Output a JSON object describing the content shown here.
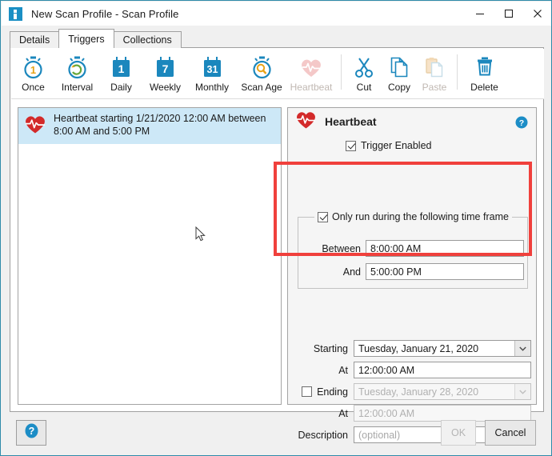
{
  "window": {
    "title": "New Scan Profile - Scan Profile",
    "icon": "app-icon",
    "controls": {
      "minimize": "minimize-icon",
      "maximize": "maximize-icon",
      "close": "close-icon"
    }
  },
  "tabs": [
    {
      "label": "Details",
      "active": false
    },
    {
      "label": "Triggers",
      "active": true
    },
    {
      "label": "Collections",
      "active": false
    }
  ],
  "toolbar": {
    "items": [
      {
        "label": "Once",
        "icon": "stopwatch-1-icon",
        "disabled": false
      },
      {
        "label": "Interval",
        "icon": "stopwatch-loop-icon",
        "disabled": false
      },
      {
        "label": "Daily",
        "icon": "calendar-1-icon",
        "disabled": false
      },
      {
        "label": "Weekly",
        "icon": "calendar-7-icon",
        "disabled": false
      },
      {
        "label": "Monthly",
        "icon": "calendar-31-icon",
        "disabled": false
      },
      {
        "label": "Scan Age",
        "icon": "stopwatch-search-icon",
        "disabled": false
      },
      {
        "label": "Heartbeat",
        "icon": "heartbeat-icon",
        "disabled": true
      }
    ],
    "clipboard": [
      {
        "label": "Cut",
        "icon": "scissors-icon",
        "disabled": false
      },
      {
        "label": "Copy",
        "icon": "copy-icon",
        "disabled": false
      },
      {
        "label": "Paste",
        "icon": "paste-icon",
        "disabled": true
      }
    ],
    "delete": {
      "label": "Delete",
      "icon": "trash-icon",
      "disabled": false
    }
  },
  "trigger_list": {
    "items": [
      {
        "icon": "heartbeat-icon",
        "text": "Heartbeat starting 1/21/2020 12:00 AM between 8:00 AM and 5:00 PM",
        "selected": true
      }
    ]
  },
  "detail": {
    "icon": "heartbeat-icon",
    "title": "Heartbeat",
    "help_icon": "help-icon",
    "trigger_enabled": {
      "label": "Trigger Enabled",
      "checked": true
    },
    "time_frame": {
      "label": "Only run during the following time frame",
      "checked": true,
      "highlighted": true,
      "fields": [
        {
          "label": "Between",
          "value": "8:00:00 AM"
        },
        {
          "label": "And",
          "value": "5:00:00 PM"
        }
      ]
    },
    "schedule": {
      "starting": {
        "label": "Starting",
        "value": "Tuesday, January 21, 2020",
        "type": "combo",
        "disabled": false
      },
      "starting_at": {
        "label": "At",
        "value": "12:00:00 AM",
        "type": "text",
        "disabled": false
      },
      "ending": {
        "label": "Ending",
        "value": "Tuesday, January 28, 2020",
        "type": "combo",
        "checked": false,
        "disabled": true
      },
      "ending_at": {
        "label": "At",
        "value": "12:00:00 AM",
        "type": "text",
        "disabled": true
      },
      "description": {
        "label": "Description",
        "placeholder": "(optional)",
        "value": "",
        "type": "text",
        "disabled": false
      }
    }
  },
  "footer": {
    "help_icon": "help-icon",
    "ok_label": "OK",
    "ok_disabled": true,
    "cancel_label": "Cancel"
  },
  "colors": {
    "accent": "#1a8fc4",
    "highlight_red": "#f0403c",
    "selection_blue": "#cde8f7",
    "heart_red": "#d32a2a",
    "window_border": "#2e8baa"
  }
}
